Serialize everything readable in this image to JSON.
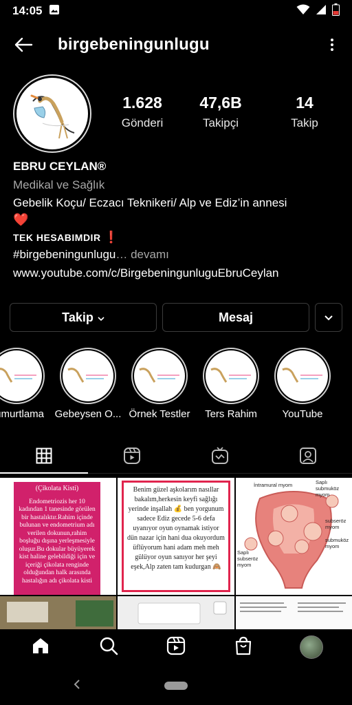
{
  "status": {
    "time": "14:05"
  },
  "header": {
    "username": "birgebeningunlugu"
  },
  "stats": [
    {
      "value": "1.628",
      "label": "Gönderi"
    },
    {
      "value": "47,6B",
      "label": "Takipçi"
    },
    {
      "value": "14",
      "label": "Takip"
    }
  ],
  "bio": {
    "name": "EBRU CEYLAN®",
    "category": "Medikal ve Sağlık",
    "line1": "Gebelik Koçu/ Eczacı Teknikeri/ Alp ve Ediz’in annesi",
    "heart": "❤️",
    "line2": "TEK HESABIMDIR",
    "exclaim": "❗",
    "hashtag": "#birgebeningunlugu",
    "more": "… devamı",
    "link": "www.youtube.com/c/BirgebeningunluguEbruCeylan"
  },
  "actions": {
    "follow": "Takip",
    "message": "Mesaj"
  },
  "highlights": [
    {
      "label": "Yumurtlama"
    },
    {
      "label": "Gebeysen O..."
    },
    {
      "label": "Örnek Testler"
    },
    {
      "label": "Ters Rahim"
    },
    {
      "label": "YouTube"
    }
  ],
  "posts": {
    "post1": {
      "title": "(Çikolata Kisti)",
      "body": "Endometriozis her 10 kadından 1 tanesinde görülen bir hastalıktır.Rahim içinde bulunan ve endometrium adı verilen dokunun,rahim boşluğu dışına yerleşmesiyle oluşur.Bu dokular büyüyerek kist haline gelebildiği için ve içeriği çikolata renginde olduğundan halk arasında hastalığın adı çikolata kisti"
    },
    "post2": {
      "body": "Benim güzel aşkolarım nasıllar bakalım,herkesin keyfi sağlığı yerinde inşallah 💰 ben yorgunum sadece Ediz gecede 5-6 defa uyanıyor oyun oynamak istiyor dün nazar için hani dua okuyordum üflüyorum hani adam meh meh gülüyor oyun sanıyor her şeyi eşek,Alp zaten tam kudurgan 🙈"
    },
    "post3": {
      "labels": [
        "İntramural myom",
        "Saplı submuköz myom",
        "subseröz myom",
        "submuköz myom",
        "Saplı subseröz myom"
      ]
    }
  },
  "colors": {
    "background": "#000000",
    "post_pink": "#d1216b",
    "post_red_border": "#e0244d"
  }
}
